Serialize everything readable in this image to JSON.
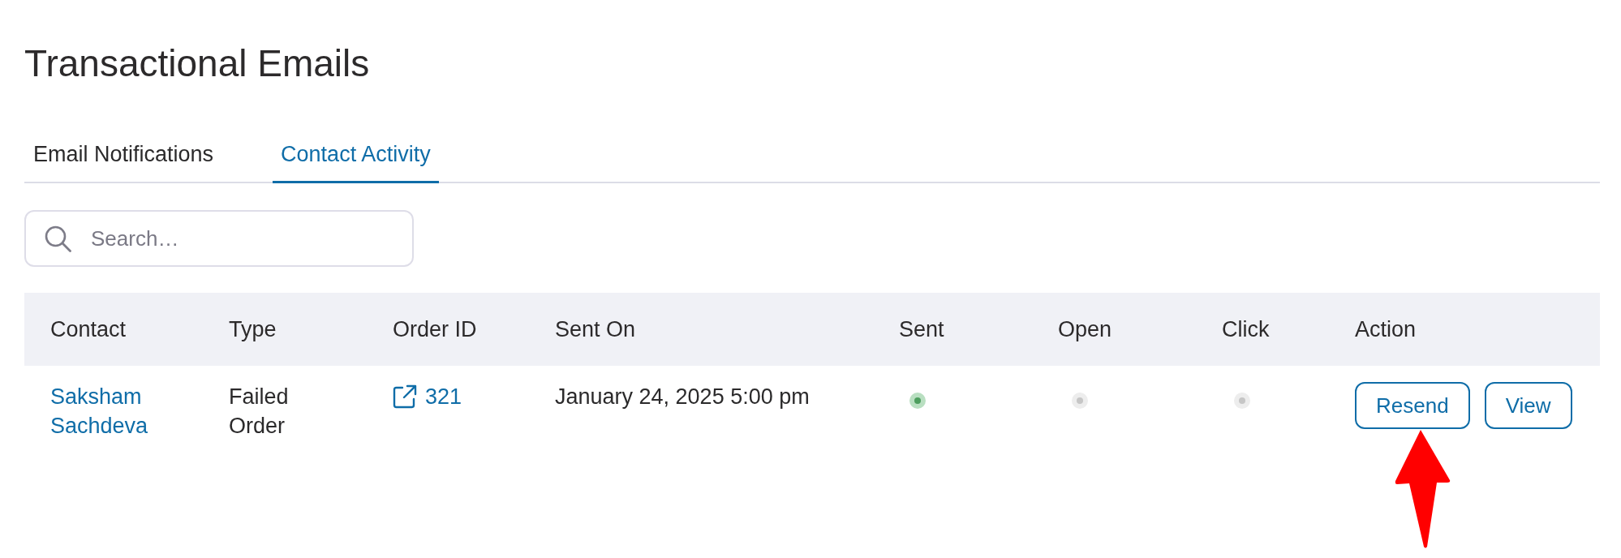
{
  "page": {
    "title": "Transactional Emails"
  },
  "tabs": [
    {
      "label": "Email Notifications",
      "selected": false
    },
    {
      "label": "Contact Activity",
      "selected": true
    }
  ],
  "search": {
    "placeholder": "Search…"
  },
  "table": {
    "columns": [
      "Contact",
      "Type",
      "Order ID",
      "Sent On",
      "Sent",
      "Open",
      "Click",
      "Action"
    ],
    "rows": [
      {
        "contact": "Saksham Sachdeva",
        "type": "Failed Order",
        "order_id": "321",
        "sent_on": "January 24, 2025 5:00 pm",
        "sent": true,
        "open": false,
        "click": false,
        "actions": [
          "Resend",
          "View"
        ]
      }
    ]
  }
}
